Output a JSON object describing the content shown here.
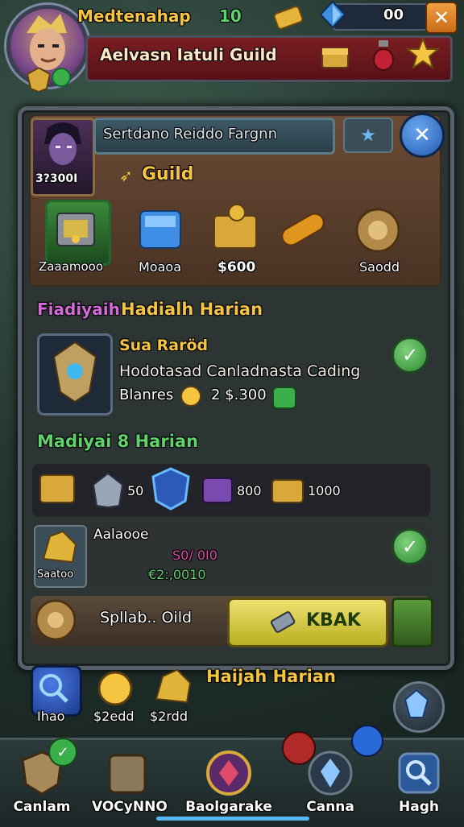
{
  "top_bar": {
    "player_name": "Medtenahap",
    "level": "10",
    "currency_value": "00",
    "guild_banner_title": "Aelvasn Iatuli Guild"
  },
  "panel": {
    "name_field": "Sertdano Reiddo Fargnn",
    "hero_power": "3?300I",
    "guild_label": "Guild",
    "rewards": [
      {
        "label": "Zaaamooo",
        "icon": "treasure-chest-icon"
      },
      {
        "label": "Moaoa",
        "icon": "crystal-box-icon"
      },
      {
        "label": "$600",
        "icon": "gold-chest-icon"
      },
      {
        "label": "",
        "icon": "golden-scroll-icon"
      },
      {
        "label": "Saodd",
        "icon": "gear-medal-icon"
      }
    ],
    "section1": {
      "title_prefix": "Fiadiyaih",
      "title": "Hadialh Harian",
      "item_name": "Sua Raröd",
      "item_desc": "Hodotasad Canladnasta Cading",
      "item_cost_label": "Blanres",
      "item_cost": "2 $.300"
    },
    "section2": {
      "title": "Madiyai 8 Harian",
      "row_values": [
        "50",
        "800",
        "1000"
      ],
      "card_name": "Aalaooe",
      "card_value_a": "S0/ 0I0",
      "card_value_b": "€2:,0010",
      "card_slot_label": "Saatoo"
    },
    "footer": {
      "left_label": "Spllab.. Oild",
      "action_button": "KBAK"
    }
  },
  "below_panel": {
    "title": "Haijah Harian",
    "items": [
      {
        "label": "Ihao",
        "icon": "magnify-icon"
      },
      {
        "label": "$2edd",
        "icon": "gold-coin-icon"
      },
      {
        "label": "$2rdd",
        "icon": "gold-ore-icon"
      }
    ]
  },
  "bottom_nav": [
    {
      "label": "Canlam",
      "icon": "shield-icon"
    },
    {
      "label": "VOCyNNO",
      "icon": "crest-icon"
    },
    {
      "label": "Baolgarake",
      "icon": "gem-shield-icon"
    },
    {
      "label": "Canna",
      "icon": "crystal-icon"
    },
    {
      "label": "Hagh",
      "icon": "search-icon"
    }
  ],
  "colors": {
    "accent_gold": "#f5c542",
    "accent_green": "#5fd36a",
    "banner_red": "#7a1e22",
    "panel_bg": "#2c3434"
  }
}
